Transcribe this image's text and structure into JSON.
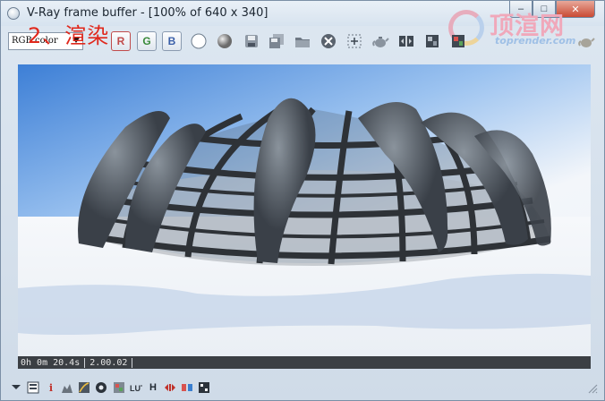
{
  "window": {
    "title": "V-Ray frame buffer - [100% of 640 x 340]",
    "controls": {
      "minimize": "–",
      "maximize": "□",
      "close": "✕"
    }
  },
  "watermark": {
    "text": "顶渲网",
    "sub": "toprender.com"
  },
  "annotation": {
    "text": "2、渲染"
  },
  "toolbar": {
    "channel": "RGB color",
    "buttons": [
      {
        "name": "red-channel-button",
        "label": "R"
      },
      {
        "name": "green-channel-button",
        "label": "G"
      },
      {
        "name": "blue-channel-button",
        "label": "B"
      }
    ]
  },
  "status": {
    "time": "0h  0m 20.4s",
    "version": "2.00.02"
  },
  "bottom_toolbar": {
    "info_label": "i",
    "h_label": "H"
  },
  "colors": {
    "accent_close": "#c94a33",
    "annotation": "#e0281c",
    "sky": "#3d7fd6"
  }
}
